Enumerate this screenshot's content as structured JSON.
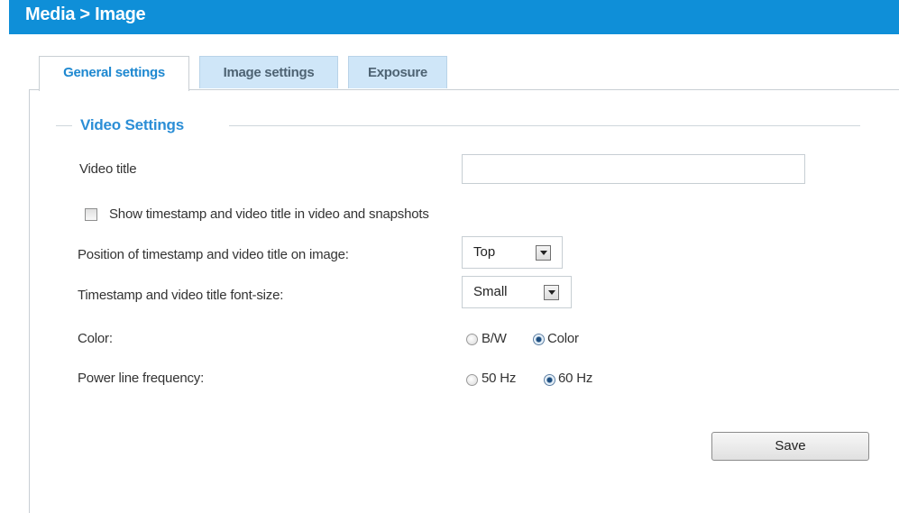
{
  "header": {
    "title": "Media > Image"
  },
  "tabs": [
    {
      "label": "General settings",
      "active": true
    },
    {
      "label": "Image settings",
      "active": false
    },
    {
      "label": "Exposure",
      "active": false
    }
  ],
  "video_settings": {
    "legend": "Video Settings",
    "video_title_label": "Video title",
    "video_title_value": "",
    "show_timestamp_label": "Show timestamp and video title in video and snapshots",
    "show_timestamp_checked": false,
    "position_label": "Position of timestamp and video title on image:",
    "position_value": "Top",
    "font_size_label": "Timestamp and video title font-size:",
    "font_size_value": "Small",
    "color_label": "Color:",
    "color_options": [
      {
        "label": "B/W",
        "checked": false
      },
      {
        "label": "Color",
        "checked": true
      }
    ],
    "power_line_label": "Power line frequency:",
    "power_line_options": [
      {
        "label": "50 Hz",
        "checked": false
      },
      {
        "label": "60 Hz",
        "checked": true
      }
    ]
  },
  "actions": {
    "save_label": "Save"
  },
  "colors": {
    "header": "#0f8fd8",
    "accent": "#1e88d0",
    "tab_inactive": "#cfe6f8"
  }
}
